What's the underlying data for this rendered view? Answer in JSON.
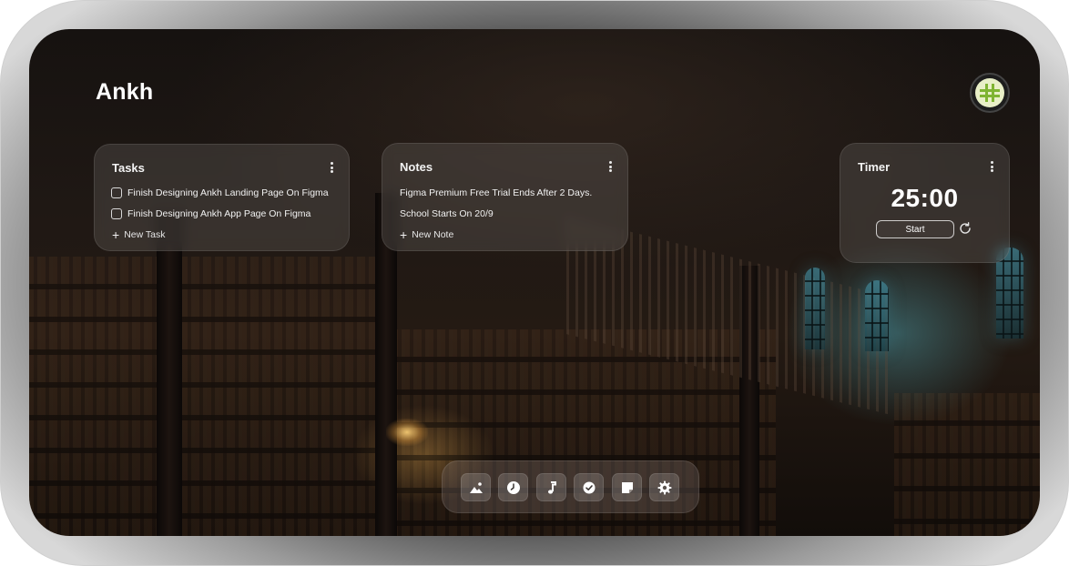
{
  "app": {
    "brand": "Ankh"
  },
  "tasks": {
    "title": "Tasks",
    "items": [
      {
        "label": "Finish Designing Ankh Landing Page On Figma",
        "checked": false
      },
      {
        "label": "Finish Designing Ankh App Page On Figma",
        "checked": false
      }
    ],
    "add_label": "New Task"
  },
  "notes": {
    "title": "Notes",
    "items": [
      "Figma Premium Free Trial Ends After 2 Days.",
      "School Starts On 20/9"
    ],
    "add_label": "New Note"
  },
  "timer": {
    "title": "Timer",
    "value": "25:00",
    "start_label": "Start"
  },
  "dock": {
    "items": [
      {
        "name": "wallpaper",
        "icon": "image-icon"
      },
      {
        "name": "clock",
        "icon": "clock-icon"
      },
      {
        "name": "music",
        "icon": "music-note-icon"
      },
      {
        "name": "tasks",
        "icon": "check-circle-icon"
      },
      {
        "name": "notes",
        "icon": "sticky-note-icon"
      },
      {
        "name": "settings",
        "icon": "gear-icon"
      }
    ]
  },
  "colors": {
    "accent": "#7fb432",
    "avatar_bg": "#e8efc7",
    "text": "#ffffff"
  }
}
